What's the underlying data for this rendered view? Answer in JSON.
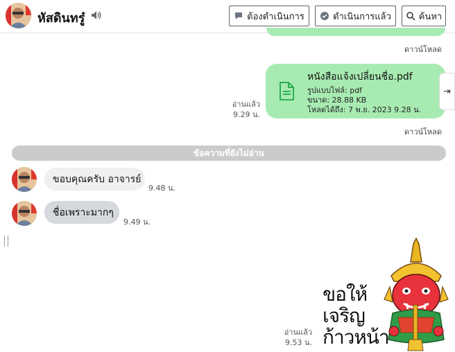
{
  "header": {
    "contact_name": "หัสดินทรู๋",
    "buttons": {
      "todo": "ต้องดำเนินการ",
      "done": "ดำเนินการแล้ว",
      "search": "ค้นหา"
    }
  },
  "messages": {
    "download_label_1": "ดาวน์โหลด",
    "file": {
      "name": "หนังสือแจ้งเปลี่ยนชื่อ.pdf",
      "format": "รูปแบบไฟล์: pdf",
      "size": "ขนาด: 28.88 KB",
      "uploaded": "โหลดได้ถึง: 7 พ.ย. 2023 9.28 น."
    },
    "file_read_label": "อ่านแล้ว",
    "file_time": "9.29 น.",
    "download_label_2": "ดาวน์โหลด",
    "unread_divider": "ข้อความที่ยังไม่อ่าน",
    "incoming": [
      {
        "text": "ขอบคุณครับ อาจารย์",
        "time": "9.48 น."
      },
      {
        "text": "ชื่อเพราะมากๆ",
        "time": "9.49 น."
      }
    ],
    "sticker": {
      "line1": "ขอให้",
      "line2": "เจริญ",
      "line3": "ก้าวหน้า"
    },
    "sticker_read_label": "อ่านแล้ว",
    "sticker_time": "9.53 น."
  },
  "colors": {
    "outgoing_bubble": "#a8ebb2",
    "incoming_bubble_1": "#eef0f2",
    "incoming_bubble_2": "#d5d8dc",
    "unread_bar": "#c9cbcd",
    "file_icon": "#1ba84a"
  }
}
